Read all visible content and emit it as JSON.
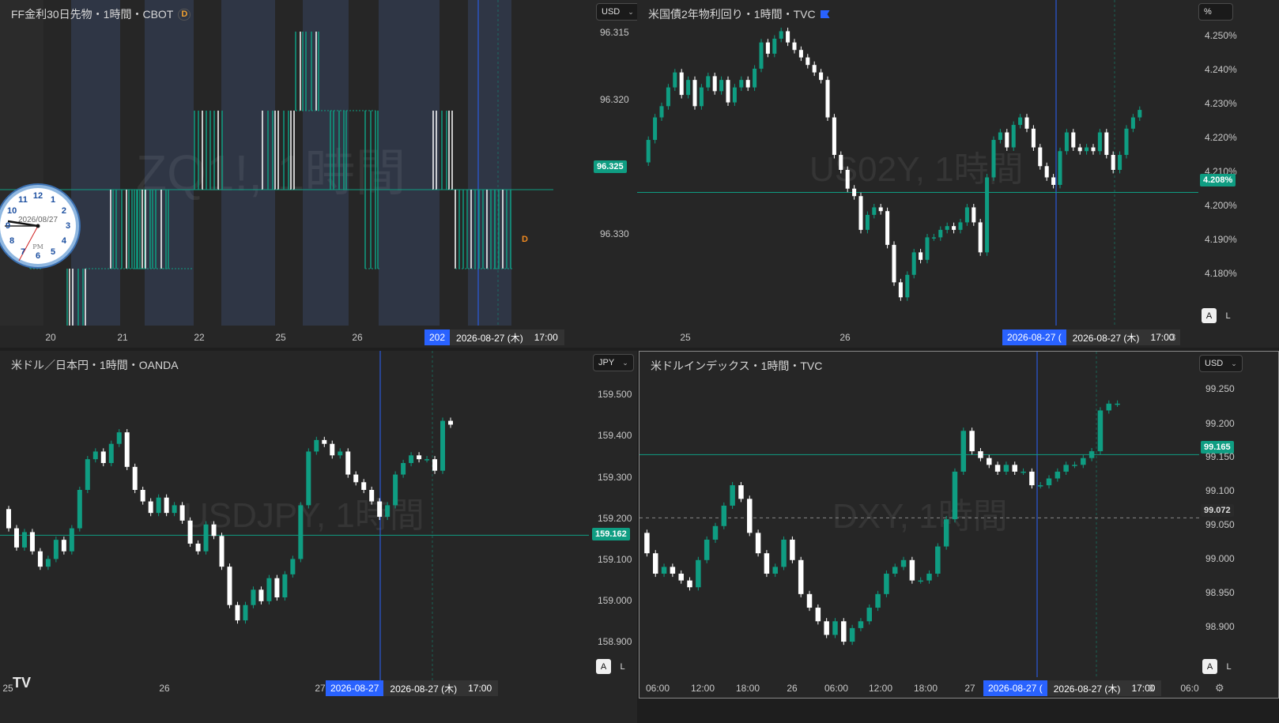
{
  "colors": {
    "up": "#0f9d82",
    "down": "#ffffff",
    "accent": "#2962ff",
    "bg": "#262626",
    "session": "#2f3645"
  },
  "panes": [
    {
      "id": "zq",
      "title": "FF金利30日先物・1時間・CBOT",
      "badge": "D",
      "watermark": "ZQ1!, 1時間",
      "currency": "USD",
      "y_labels": [
        "96.315",
        "96.320",
        "96.325",
        "96.330"
      ],
      "price_tag": "96.325",
      "x_labels": [
        "20",
        "21",
        "22",
        "25",
        "26"
      ],
      "time_tag_blue": "202",
      "time_tag_date": "2026-08-27 (木)",
      "time_tag_time": "17:00",
      "d_marker": "D",
      "clock": {
        "date": "2026/08/27",
        "ampm": "PM",
        "numbers": [
          "12",
          "1",
          "2",
          "3",
          "4",
          "5",
          "6",
          "7",
          "8",
          "9",
          "10",
          "11"
        ]
      }
    },
    {
      "id": "us02y",
      "title": "米国債2年物利回り・1時間・TVC",
      "watermark": "US02Y, 1時間",
      "currency": "%",
      "y_labels": [
        "4.250%",
        "4.240%",
        "4.230%",
        "4.220%",
        "4.210%",
        "4.200%",
        "4.190%",
        "4.180%"
      ],
      "price_tag": "4.208%",
      "x_labels": [
        "25",
        "26"
      ],
      "time_tag_blue": "2026-08-27 (",
      "time_tag_date": "2026-08-27 (木)",
      "time_tag_time": "17:00",
      "time_tag_tail": "3",
      "auto": "A",
      "log": "L"
    },
    {
      "id": "usdjpy",
      "title": "米ドル／日本円・1時間・OANDA",
      "watermark": "USDJPY, 1時間",
      "currency": "JPY",
      "y_labels": [
        "159.500",
        "159.400",
        "159.300",
        "159.200",
        "159.100",
        "159.000",
        "158.900"
      ],
      "price_tag": "159.162",
      "x_labels": [
        "25",
        "26",
        "27"
      ],
      "time_tag_blue": "2026-08-27",
      "time_tag_date": "2026-08-27 (木)",
      "time_tag_time": "17:00",
      "auto": "A",
      "log": "L",
      "logo": "TV"
    },
    {
      "id": "dxy",
      "title": "米ドルインデックス・1時間・TVC",
      "watermark": "DXY, 1時間",
      "currency": "USD",
      "y_labels": [
        "99.250",
        "99.200",
        "99.150",
        "99.100",
        "99.050",
        "99.000",
        "98.950",
        "98.900"
      ],
      "price_tag": "99.165",
      "price_tag_grey": "99.072",
      "x_labels": [
        "06:00",
        "12:00",
        "18:00",
        "26",
        "06:00",
        "12:00",
        "18:00",
        "27",
        "06:0"
      ],
      "time_tag_blue": "2026-08-27 (",
      "time_tag_date": "2026-08-27 (木)",
      "time_tag_time": "17:00",
      "time_tag_tail": "3",
      "auto": "A",
      "log": "L"
    }
  ],
  "chart_data": [
    {
      "type": "candlestick",
      "title": "FF金利30日先物・1時間・CBOT",
      "ylim": [
        96.315,
        96.332
      ],
      "inverted_axis": true,
      "last": 96.325,
      "x": [
        "20",
        "21",
        "22",
        "25",
        "26"
      ]
    },
    {
      "type": "candlestick",
      "title": "米国債2年物利回り・1時間・TVC",
      "ylim": [
        4.175,
        4.253
      ],
      "last": 4.208,
      "closes": [
        4.222,
        4.228,
        4.231,
        4.236,
        4.24,
        4.234,
        4.238,
        4.231,
        4.236,
        4.239,
        4.235,
        4.238,
        4.232,
        4.236,
        4.238,
        4.236,
        4.241,
        4.248,
        4.245,
        4.249,
        4.251,
        4.248,
        4.246,
        4.244,
        4.242,
        4.24,
        4.238,
        4.228,
        4.218,
        4.214,
        4.209,
        4.207,
        4.198,
        4.202,
        4.204,
        4.203,
        4.194,
        4.184,
        4.18,
        4.186,
        4.192,
        4.19,
        4.196,
        4.196,
        4.198,
        4.199,
        4.198,
        4.2,
        4.204,
        4.2,
        4.192,
        4.212,
        4.222,
        4.224,
        4.22,
        4.226,
        4.228,
        4.225,
        4.22,
        4.215,
        4.212,
        4.21,
        4.219,
        4.224,
        4.22,
        4.219,
        4.22,
        4.219,
        4.224,
        4.218,
        4.214,
        4.218,
        4.225,
        4.228,
        4.23
      ],
      "x": [
        "25",
        "26"
      ]
    },
    {
      "type": "candlestick",
      "title": "米ドル／日本円・1時間・OANDA",
      "ylim": [
        158.86,
        159.56
      ],
      "last": 159.162,
      "closes": [
        159.18,
        159.13,
        159.17,
        159.12,
        159.08,
        159.1,
        159.15,
        159.12,
        159.18,
        159.28,
        159.36,
        159.38,
        159.35,
        159.4,
        159.43,
        159.34,
        159.28,
        159.25,
        159.22,
        159.26,
        159.22,
        159.24,
        159.2,
        159.14,
        159.12,
        159.19,
        159.16,
        159.08,
        158.98,
        158.94,
        158.98,
        159.02,
        158.99,
        159.05,
        159.0,
        159.06,
        159.1,
        159.24,
        159.38,
        159.41,
        159.4,
        159.37,
        159.38,
        159.32,
        159.3,
        159.28,
        159.25,
        159.21,
        159.24,
        159.32,
        159.35,
        159.37,
        159.36,
        159.36,
        159.33,
        159.46,
        159.45
      ],
      "x": [
        "25",
        "26",
        "27"
      ]
    },
    {
      "type": "candlestick",
      "title": "米ドルインデックス・1時間・TVC",
      "ylim": [
        98.875,
        99.27
      ],
      "last": 99.165,
      "closes": [
        99.02,
        98.99,
        99.0,
        98.99,
        98.98,
        98.97,
        99.01,
        99.04,
        99.06,
        99.09,
        99.12,
        99.1,
        99.05,
        99.02,
        98.99,
        99.0,
        99.04,
        99.01,
        98.96,
        98.94,
        98.92,
        98.9,
        98.92,
        98.89,
        98.91,
        98.92,
        98.94,
        98.96,
        98.99,
        99.0,
        99.01,
        98.98,
        98.98,
        98.99,
        99.03,
        99.07,
        99.14,
        99.2,
        99.17,
        99.16,
        99.15,
        99.14,
        99.15,
        99.14,
        99.14,
        99.12,
        99.12,
        99.13,
        99.14,
        99.15,
        99.15,
        99.16,
        99.17,
        99.23,
        99.24,
        99.24
      ],
      "x": [
        "06:00",
        "12:00",
        "18:00",
        "26",
        "06:00",
        "12:00",
        "18:00",
        "27"
      ]
    }
  ]
}
